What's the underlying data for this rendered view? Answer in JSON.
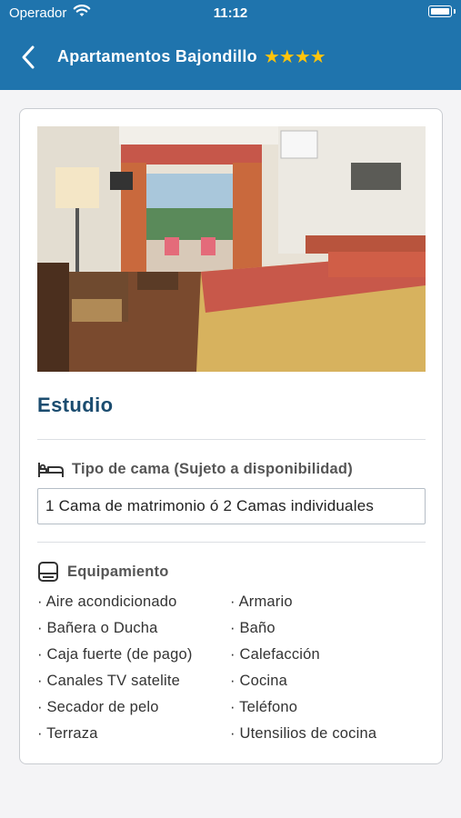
{
  "status_bar": {
    "carrier": "Operador",
    "time": "11:12"
  },
  "nav": {
    "title": "Apartamentos Bajondillo",
    "stars": "★★★★",
    "star_count": 4,
    "back_icon": "chevron-left-icon"
  },
  "room": {
    "name": "Estudio"
  },
  "bed": {
    "label": "Tipo de cama (Sujeto a disponibilidad)",
    "value": "1 Cama de matrimonio ó 2 Camas individuales",
    "icon": "bed-icon"
  },
  "equipment": {
    "label": "Equipamiento",
    "icon": "equipment-icon",
    "left": [
      "· Aire acondicionado",
      "· Bañera o Ducha",
      "· Caja fuerte (de pago)",
      "· Canales TV satelite",
      "· Secador de pelo",
      "· Terraza"
    ],
    "right": [
      "· Armario",
      "· Baño",
      "· Calefacción",
      "· Cocina",
      "· Teléfono",
      "· Utensilios de cocina"
    ]
  },
  "colors": {
    "header": "#1f74ad",
    "accent_title": "#1b4c6f",
    "stars": "#ffc40c"
  }
}
